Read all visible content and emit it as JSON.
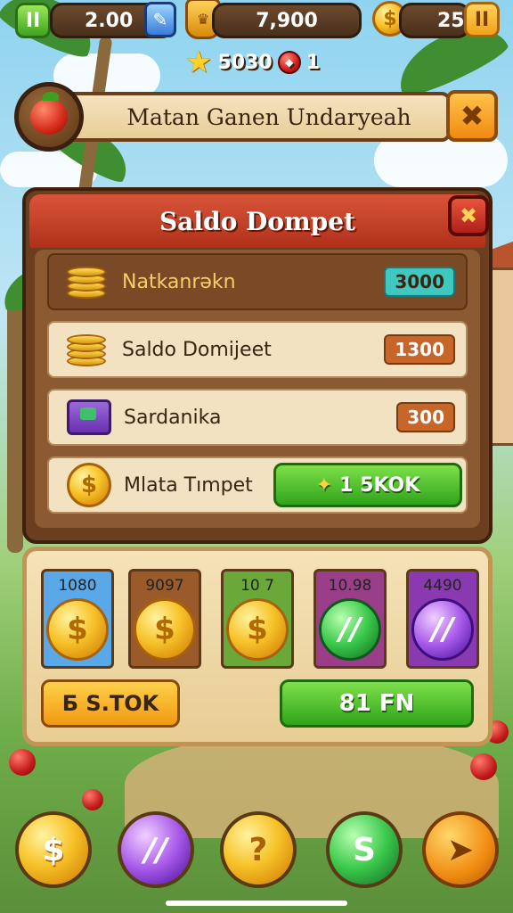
{
  "hud": {
    "energy_value": "2.00",
    "gold_value": "7,900",
    "coins_value": "25",
    "stars_value": "5030",
    "rubies_value": "1",
    "left_button": "II",
    "right_button": "II"
  },
  "header": {
    "title": "Matan Ganen Undaryeah",
    "close_label": "✖"
  },
  "wallet": {
    "title": "Saldo Dompet",
    "close_label": "✖",
    "rows": [
      {
        "label": "Natkanrəkn",
        "value": "3000",
        "color": "#3fc8c0"
      },
      {
        "label": "Saldo Domijeet",
        "value": "1300",
        "color": "#c8662a"
      },
      {
        "label": "Sardanika",
        "value": "300",
        "color": "#c8662a"
      }
    ],
    "withdraw_label": "Mlata Tımpet",
    "withdraw_button": "1 5KOK",
    "withdraw_icon": "✦"
  },
  "shop": {
    "packs": [
      {
        "amount": "1080",
        "symbol": "$",
        "bg": "#5aa8e8"
      },
      {
        "amount": "9097",
        "symbol": "$",
        "bg": "#9a5a2a"
      },
      {
        "amount": "10 7",
        "symbol": "$",
        "bg": "#6aa83a"
      },
      {
        "amount": "10.98",
        "symbol": "//",
        "bg": "#9a3e8a"
      },
      {
        "amount": "4490",
        "symbol": "//",
        "bg": "#8a3ab0"
      }
    ],
    "left_button": "Б S.TOK",
    "right_button": "81 FN"
  },
  "nav": {
    "items": [
      {
        "symbol": "$",
        "kind": "coin"
      },
      {
        "symbol": "//",
        "kind": "amethyst"
      },
      {
        "symbol": "?",
        "kind": "coin"
      },
      {
        "symbol": "S",
        "kind": "emerald"
      },
      {
        "symbol": "➤",
        "kind": "orange"
      }
    ]
  },
  "colors": {
    "accent_green": "#3fa41f",
    "panel_brown": "#6b3e1f",
    "header_red": "#b0301a",
    "gold": "#f7c32a"
  }
}
